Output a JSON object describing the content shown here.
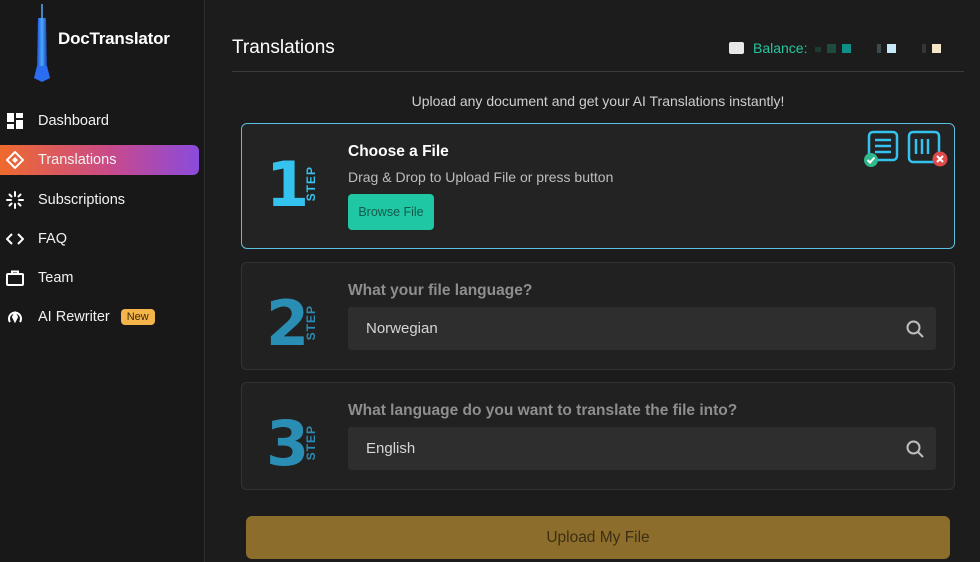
{
  "app": {
    "logo_text": "DocTranslator"
  },
  "sidebar": {
    "items": [
      {
        "label": "Dashboard",
        "icon": "dashboard-icon"
      },
      {
        "label": "Translations",
        "icon": "translations-icon",
        "active": true
      },
      {
        "label": "Subscriptions",
        "icon": "subscriptions-icon"
      },
      {
        "label": "FAQ",
        "icon": "code-brackets-icon"
      },
      {
        "label": "Team",
        "icon": "briefcase-icon"
      },
      {
        "label": "AI Rewriter",
        "icon": "ai-rewriter-icon",
        "badge": "New"
      }
    ]
  },
  "header": {
    "title": "Translations",
    "balance_label": "Balance:"
  },
  "main": {
    "subtitle": "Upload any document and get your AI Translations instantly!",
    "steps": [
      {
        "number": "1",
        "word": "STEP",
        "title": "Choose a File",
        "description": "Drag & Drop to Upload File or press button",
        "button_label": "Browse File"
      },
      {
        "number": "2",
        "word": "STEP",
        "title": "What your file language?",
        "value": "Norwegian"
      },
      {
        "number": "3",
        "word": "STEP",
        "title": "What language do you want to translate the file into?",
        "value": "English"
      }
    ],
    "upload_button_label": "Upload My File"
  },
  "colors": {
    "accent_teal": "#1fc7a4",
    "step_active": "#34c3ee",
    "step_inactive": "#2a8db3",
    "upload_button": "#8d6d2b",
    "badge_new": "#f5b44a"
  }
}
